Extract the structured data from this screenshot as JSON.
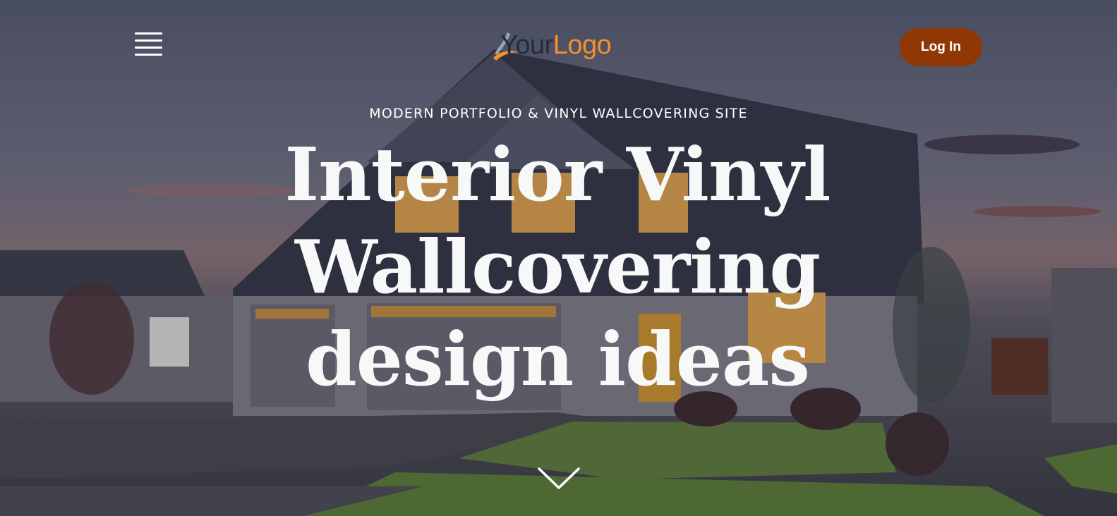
{
  "header": {
    "menu_icon": "hamburger-menu-icon",
    "logo": {
      "part1": "Your",
      "part2": "Logo"
    },
    "login_label": "Log In"
  },
  "hero": {
    "tagline": "MODERN PORTFOLIO & VINYL WALLCOVERING SITE",
    "headline": "Interior Vinyl Wallcovering design ideas",
    "scroll_icon": "chevron-down-icon"
  },
  "colors": {
    "login_button": "#8f3806",
    "logo_dark": "#1f2d3f",
    "logo_accent": "#f2902a",
    "headline_text": "#f7f9f8"
  }
}
